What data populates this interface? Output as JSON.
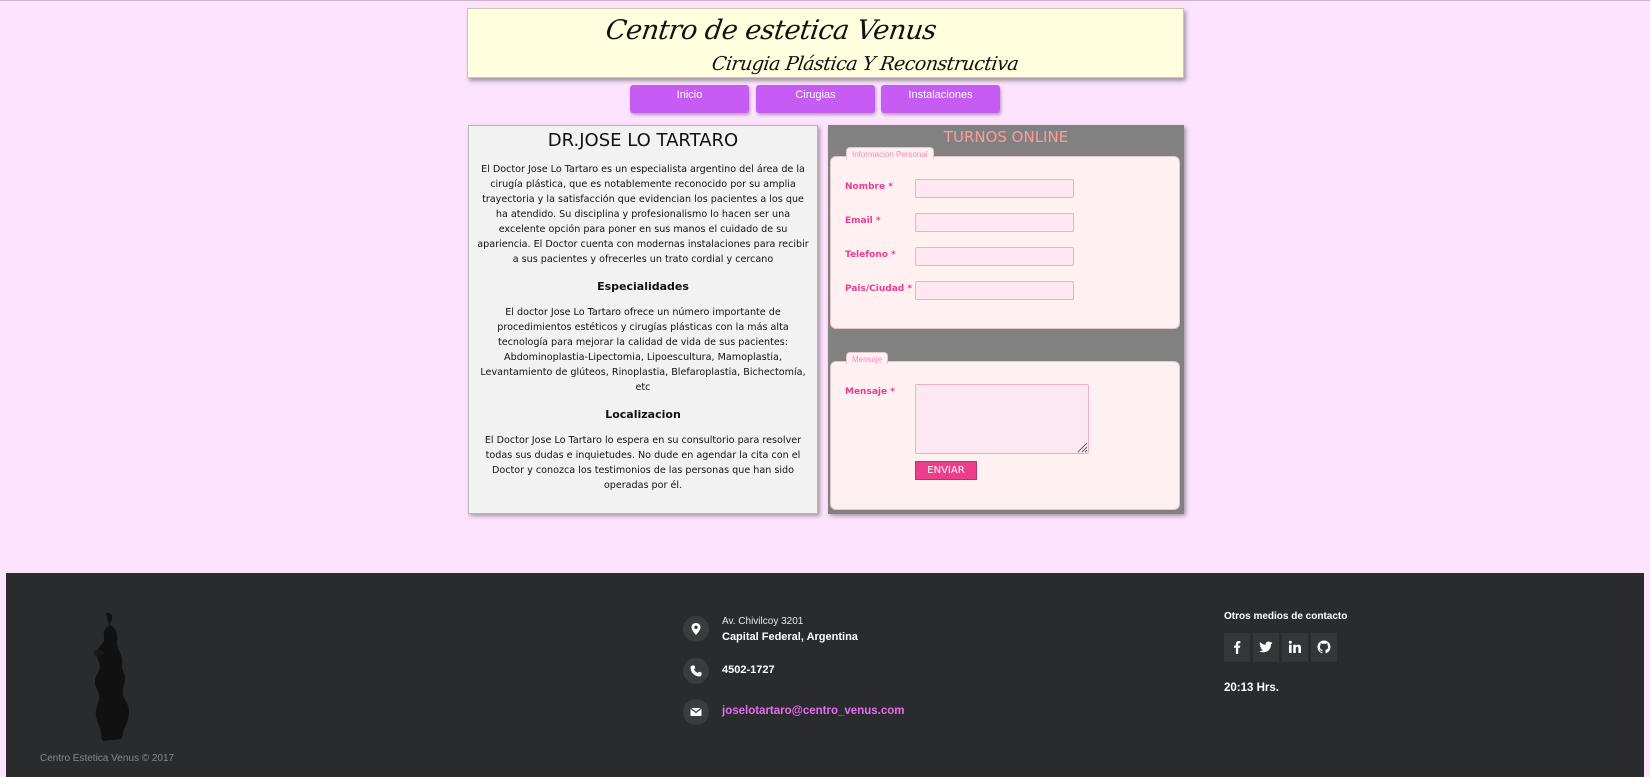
{
  "header": {
    "line1": "Centro de estetica Venus",
    "line2": "Cirugia Plástica Y Reconstructiva"
  },
  "nav": {
    "items": [
      "Inicio",
      "Cirugias",
      "Instalaciones"
    ]
  },
  "doctor": {
    "title": "DR.JOSE LO TARTARO",
    "intro": "El Doctor Jose Lo Tartaro es un especialista argentino del área de la cirugía plástica, que es notablemente reconocido por su amplia trayectoria y la satisfacción que evidencian los pacientes a los que ha atendido. Su disciplina y profesionalismo lo hacen ser una excelente opción para poner en sus manos el cuidado de su apariencia. El Doctor cuenta con modernas instalaciones para recibir a sus pacientes y ofrecerles un trato cordial y cercano",
    "specialties_heading": "Especialidades",
    "specialties_text": "El doctor Jose Lo Tartaro ofrece un número importante de procedimientos estéticos y cirugías plásticas con la más alta tecnología para mejorar la calidad de vida de sus pacientes: Abdominoplastia-Lipectomia, Lipoescultura, Mamoplastia, Levantamiento de glúteos, Rinoplastia, Blefaroplastia, Bichectomía, etc",
    "location_heading": "Localizacion",
    "location_text": "El Doctor Jose Lo Tartaro lo espera en su consultorio para resolver todas sus dudas e inquietudes. No dude en agendar la cita con el Doctor y conozca los testimonios de las personas que han sido operadas por él."
  },
  "form": {
    "title": "TURNOS ONLINE",
    "personal_legend": "Informacion Personal",
    "fields": [
      {
        "label": "Nombre *",
        "value": ""
      },
      {
        "label": "Email *",
        "value": ""
      },
      {
        "label": "Telefono *",
        "value": ""
      },
      {
        "label": "Pais/Ciudad *",
        "value": ""
      }
    ],
    "message_legend": "Mensaje",
    "message_label": "Mensaje *",
    "message_value": "",
    "submit_label": "ENVIAR"
  },
  "footer": {
    "copyright": "Centro Estetica Venus © 2017",
    "address_line1": "Av. Chivilcoy 3201",
    "address_line2": "Capital Federal, Argentina",
    "phone": "4502-1727",
    "email": "joselotartaro@centro_venus.com",
    "contact_heading": "Otros medios de contacto",
    "social_icons": [
      "facebook-icon",
      "twitter-icon",
      "linkedin-icon",
      "github-icon"
    ],
    "time": "20:13 Hrs."
  },
  "colors": {
    "page_background": "#fde3fe",
    "nav_button": "#c65cf3",
    "form_panel": "#818181",
    "form_title": "#ff9b9b",
    "field_label": "#e83f8b",
    "submit_button": "#ec3e8a",
    "footer_background": "#292b2d",
    "email_link": "#e76cf0"
  }
}
